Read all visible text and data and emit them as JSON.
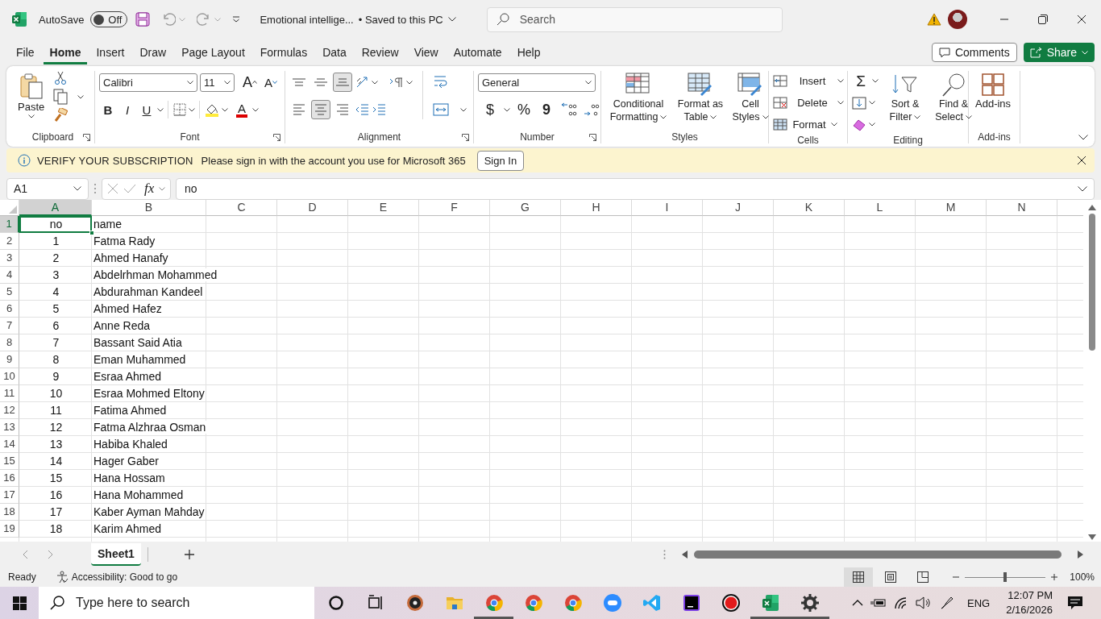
{
  "title_bar": {
    "autosave_label": "AutoSave",
    "autosave": {
      "on": false,
      "label": "Off"
    },
    "document_title": "Emotional intellige...",
    "save_status": "•  Saved to this PC",
    "search": {
      "placeholder": "Search"
    }
  },
  "menu_tabs": [
    {
      "label": "File",
      "selected": false
    },
    {
      "label": "Home",
      "selected": true
    },
    {
      "label": "Insert",
      "selected": false
    },
    {
      "label": "Draw",
      "selected": false
    },
    {
      "label": "Page Layout",
      "selected": false
    },
    {
      "label": "Formulas",
      "selected": false
    },
    {
      "label": "Data",
      "selected": false
    },
    {
      "label": "Review",
      "selected": false
    },
    {
      "label": "View",
      "selected": false
    },
    {
      "label": "Automate",
      "selected": false
    },
    {
      "label": "Help",
      "selected": false
    }
  ],
  "header_buttons": [
    {
      "kind": "comments",
      "label": "Comments"
    },
    {
      "kind": "share",
      "label": "Share"
    }
  ],
  "ribbon": {
    "clipboard": {
      "group": "Clipboard",
      "paste": "Paste"
    },
    "font": {
      "group": "Font",
      "font_name": "Calibri",
      "font_size": "11",
      "grow": "A",
      "shrink": "A",
      "styles": [
        "B",
        "I",
        "U"
      ],
      "font_color": "A"
    },
    "alignment": {
      "group": "Alignment",
      "vertical": [
        {
          "selected": false
        },
        {
          "selected": false
        },
        {
          "selected": true
        }
      ],
      "horizontal": [
        {
          "selected": false
        },
        {
          "selected": true
        },
        {
          "selected": false
        }
      ]
    },
    "number": {
      "group": "Number",
      "format": "General",
      "symbols": [
        "$",
        "%",
        "9"
      ]
    },
    "styles": {
      "group": "Styles",
      "buttons": [
        "Conditional Formatting",
        "Format as Table",
        "Cell Styles"
      ]
    },
    "cells": {
      "group": "Cells",
      "buttons": [
        "Insert",
        "Delete",
        "Format"
      ]
    },
    "editing": {
      "group": "Editing",
      "sum": "Σ",
      "buttons": [
        "Sort & Filter",
        "Find & Select"
      ]
    },
    "addins": {
      "group": "Add-ins",
      "button": "Add-ins"
    }
  },
  "banner": {
    "title": "VERIFY YOUR SUBSCRIPTION",
    "message": "Please sign in with the account you use for Microsoft 365",
    "button": "Sign In"
  },
  "formula_bar": {
    "name_box": "A1",
    "function_label": "fx",
    "formula": "no"
  },
  "sheet": {
    "columns": [
      {
        "label": "A",
        "selected": true
      },
      {
        "label": "B",
        "selected": false
      },
      {
        "label": "C",
        "selected": false
      },
      {
        "label": "D",
        "selected": false
      },
      {
        "label": "E",
        "selected": false
      },
      {
        "label": "F",
        "selected": false
      },
      {
        "label": "G",
        "selected": false
      },
      {
        "label": "H",
        "selected": false
      },
      {
        "label": "I",
        "selected": false
      },
      {
        "label": "J",
        "selected": false
      },
      {
        "label": "K",
        "selected": false
      },
      {
        "label": "L",
        "selected": false
      },
      {
        "label": "M",
        "selected": false
      },
      {
        "label": "N",
        "selected": false
      }
    ],
    "rows": [
      {
        "number": "1",
        "selected": true,
        "cells": [
          "no",
          "name"
        ]
      },
      {
        "number": "2",
        "selected": false,
        "cells": [
          "1",
          "Fatma Rady"
        ]
      },
      {
        "number": "3",
        "selected": false,
        "cells": [
          "2",
          "Ahmed Hanafy"
        ]
      },
      {
        "number": "4",
        "selected": false,
        "cells": [
          "3",
          "Abdelrhman Mohammed"
        ]
      },
      {
        "number": "5",
        "selected": false,
        "cells": [
          "4",
          "Abdurahman Kandeel"
        ]
      },
      {
        "number": "6",
        "selected": false,
        "cells": [
          "5",
          "Ahmed Hafez"
        ]
      },
      {
        "number": "7",
        "selected": false,
        "cells": [
          "6",
          "Anne Reda"
        ]
      },
      {
        "number": "8",
        "selected": false,
        "cells": [
          "7",
          "Bassant Said Atia"
        ]
      },
      {
        "number": "9",
        "selected": false,
        "cells": [
          "8",
          "Eman Muhammed"
        ]
      },
      {
        "number": "10",
        "selected": false,
        "cells": [
          "9",
          "Esraa Ahmed"
        ]
      },
      {
        "number": "11",
        "selected": false,
        "cells": [
          "10",
          "Esraa Mohmed Eltony"
        ]
      },
      {
        "number": "12",
        "selected": false,
        "cells": [
          "11",
          "Fatima Ahmed"
        ]
      },
      {
        "number": "13",
        "selected": false,
        "cells": [
          "12",
          "Fatma Alzhraa Osman"
        ]
      },
      {
        "number": "14",
        "selected": false,
        "cells": [
          "13",
          "Habiba Khaled"
        ]
      },
      {
        "number": "15",
        "selected": false,
        "cells": [
          "14",
          "Hager Gaber"
        ]
      },
      {
        "number": "16",
        "selected": false,
        "cells": [
          "15",
          "Hana Hossam"
        ]
      },
      {
        "number": "17",
        "selected": false,
        "cells": [
          "16",
          "Hana Mohammed"
        ]
      },
      {
        "number": "18",
        "selected": false,
        "cells": [
          "17",
          "Kaber Ayman Mahday"
        ]
      },
      {
        "number": "19",
        "selected": false,
        "cells": [
          "18",
          "Karim Ahmed"
        ]
      }
    ]
  },
  "sheet_tabs": [
    {
      "label": "Sheet1",
      "selected": true
    }
  ],
  "status_bar": {
    "mode": "Ready",
    "accessibility": "Accessibility: Good to go",
    "views": [
      {
        "selected": true
      },
      {
        "selected": false
      },
      {
        "selected": false
      }
    ],
    "zoom": {
      "level": 0.5,
      "reading": "100%"
    }
  },
  "taskbar": {
    "search": {
      "placeholder": "Type here to search"
    },
    "apps": [
      {
        "kind": "cortana",
        "running": false
      },
      {
        "kind": "taskview",
        "running": false
      },
      {
        "kind": "music",
        "running": false
      },
      {
        "kind": "folder",
        "running": false
      },
      {
        "kind": "chrome",
        "running": true
      },
      {
        "kind": "chrome",
        "running": false
      },
      {
        "kind": "chrome",
        "running": false
      },
      {
        "kind": "zoom",
        "running": false
      },
      {
        "kind": "code",
        "running": false
      },
      {
        "kind": "ide",
        "running": false
      },
      {
        "kind": "record",
        "running": false
      },
      {
        "kind": "excel",
        "running": true
      },
      {
        "kind": "settings",
        "running": true
      }
    ],
    "language": "ENG",
    "time": "12:07 PM",
    "date": "2/16/2026"
  }
}
